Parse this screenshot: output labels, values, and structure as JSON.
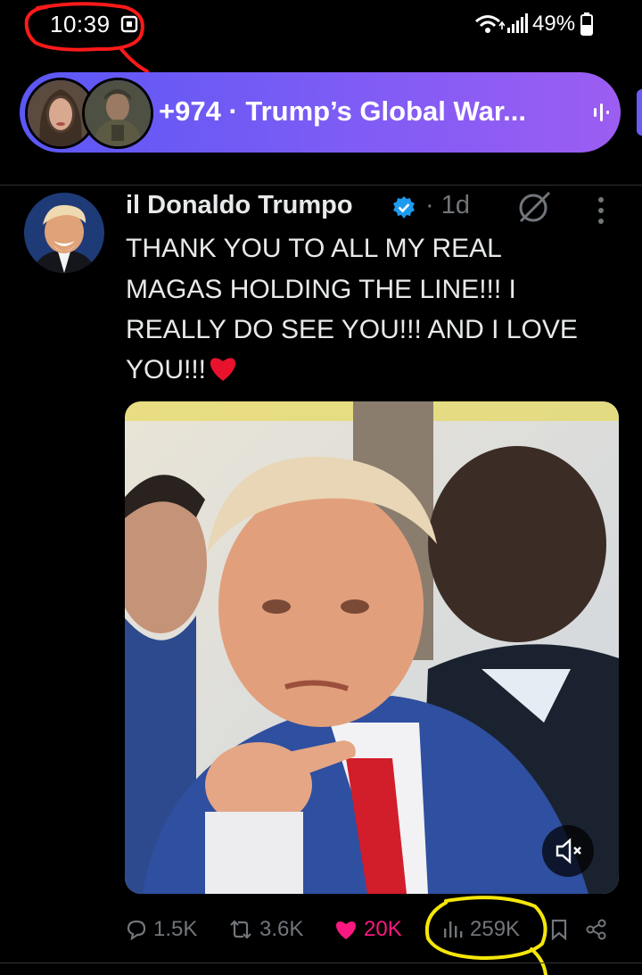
{
  "status_bar": {
    "time": "10:39",
    "battery": "49%"
  },
  "space": {
    "title": "+974 · Trump’s Global War..."
  },
  "post": {
    "author": "il Donaldo Trumpo",
    "time": "· 1d",
    "text_lines": [
      "THANK YOU TO ALL MY REAL",
      "MAGAS HOLDING THE LINE!!! I",
      "REALLY DO SEE YOU!!! AND I LOVE",
      "YOU!!!"
    ],
    "actions": {
      "replies": "1.5K",
      "reposts": "3.6K",
      "likes": "20K",
      "views": "259K"
    }
  },
  "colors": {
    "background": "#000000",
    "space_gradient_start": "#5b57f5",
    "space_gradient_end": "#9c5df2",
    "verified": "#1d9bf0",
    "like": "#f91880",
    "muted_text": "#71767b",
    "annotation_red": "#ff1a1a",
    "annotation_yellow": "#f5e60a"
  },
  "icons": [
    "rotation-lock-icon",
    "wifi-icon",
    "signal-icon",
    "battery-icon",
    "audio-wave-icon",
    "verified-badge-icon",
    "grok-icon",
    "more-vertical-icon",
    "heart-emoji-icon",
    "mute-icon",
    "reply-icon",
    "repost-icon",
    "like-icon",
    "views-icon",
    "bookmark-icon",
    "share-icon"
  ]
}
